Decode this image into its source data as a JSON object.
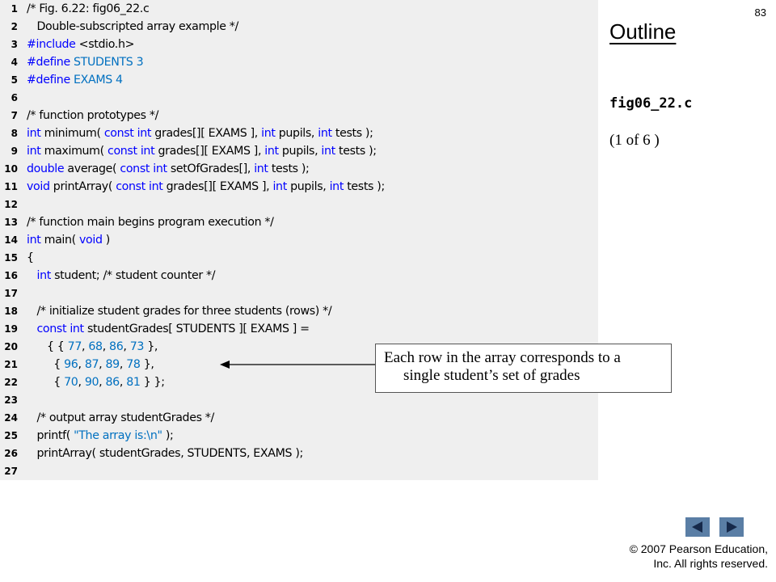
{
  "slide_number": "83",
  "outline_title": "Outline",
  "file_name": "fig06_22.c",
  "page_indicator": "(1 of 6 )",
  "callout_line1": "Each row in the array corresponds to a",
  "callout_line2": "single student’s set of grades",
  "copyright_line1": "© 2007 Pearson Education,",
  "copyright_line2": "Inc.  All rights reserved.",
  "nav": {
    "prev_icon": "triangle-left",
    "next_icon": "triangle-right"
  },
  "colors": {
    "keyword": "#0000ff",
    "literal": "#0070c0",
    "code_bg": "#efefef",
    "nav_button": "#5a7ea5"
  },
  "code_lines": [
    {
      "num": "1",
      "tokens": [
        [
          "c",
          "/* Fig. 6.22: fig06_22.c"
        ]
      ]
    },
    {
      "num": "2",
      "tokens": [
        [
          "c",
          "   Double-subscripted array example */"
        ]
      ]
    },
    {
      "num": "3",
      "tokens": [
        [
          "k",
          "#include"
        ],
        [
          "p",
          " <stdio.h>"
        ]
      ]
    },
    {
      "num": "4",
      "tokens": [
        [
          "k",
          "#define"
        ],
        [
          "p",
          " "
        ],
        [
          "n",
          "STUDENTS 3"
        ]
      ]
    },
    {
      "num": "5",
      "tokens": [
        [
          "k",
          "#define"
        ],
        [
          "p",
          " "
        ],
        [
          "n",
          "EXAMS 4"
        ]
      ]
    },
    {
      "num": "6",
      "tokens": []
    },
    {
      "num": "7",
      "tokens": [
        [
          "c",
          "/* function prototypes */"
        ]
      ]
    },
    {
      "num": "8",
      "tokens": [
        [
          "k",
          "int"
        ],
        [
          "p",
          " minimum( "
        ],
        [
          "k",
          "const int"
        ],
        [
          "p",
          " grades[][ EXAMS ], "
        ],
        [
          "k",
          "int"
        ],
        [
          "p",
          " pupils, "
        ],
        [
          "k",
          "int"
        ],
        [
          "p",
          " tests );"
        ]
      ]
    },
    {
      "num": "9",
      "tokens": [
        [
          "k",
          "int"
        ],
        [
          "p",
          " maximum( "
        ],
        [
          "k",
          "const int"
        ],
        [
          "p",
          " grades[][ EXAMS ], "
        ],
        [
          "k",
          "int"
        ],
        [
          "p",
          " pupils, "
        ],
        [
          "k",
          "int"
        ],
        [
          "p",
          " tests );"
        ]
      ]
    },
    {
      "num": "10",
      "tokens": [
        [
          "k",
          "double"
        ],
        [
          "p",
          " average( "
        ],
        [
          "k",
          "const int"
        ],
        [
          "p",
          " setOfGrades[], "
        ],
        [
          "k",
          "int"
        ],
        [
          "p",
          " tests );"
        ]
      ]
    },
    {
      "num": "11",
      "tokens": [
        [
          "k",
          "void"
        ],
        [
          "p",
          " printArray( "
        ],
        [
          "k",
          "const int"
        ],
        [
          "p",
          " grades[][ EXAMS ], "
        ],
        [
          "k",
          "int"
        ],
        [
          "p",
          " pupils, "
        ],
        [
          "k",
          "int"
        ],
        [
          "p",
          " tests );"
        ]
      ]
    },
    {
      "num": "12",
      "tokens": []
    },
    {
      "num": "13",
      "tokens": [
        [
          "c",
          "/* function main begins program execution */"
        ]
      ]
    },
    {
      "num": "14",
      "tokens": [
        [
          "k",
          "int"
        ],
        [
          "p",
          " main( "
        ],
        [
          "k",
          "void"
        ],
        [
          "p",
          " )"
        ]
      ]
    },
    {
      "num": "15",
      "tokens": [
        [
          "p",
          "{"
        ]
      ]
    },
    {
      "num": "16",
      "tokens": [
        [
          "p",
          "   "
        ],
        [
          "k",
          "int"
        ],
        [
          "p",
          " student; "
        ],
        [
          "c",
          "/* student counter */"
        ]
      ]
    },
    {
      "num": "17",
      "tokens": []
    },
    {
      "num": "18",
      "tokens": [
        [
          "p",
          "   "
        ],
        [
          "c",
          "/* initialize student grades for three students (rows) */"
        ]
      ]
    },
    {
      "num": "19",
      "tokens": [
        [
          "p",
          "   "
        ],
        [
          "k",
          "const int"
        ],
        [
          "p",
          " studentGrades[ STUDENTS ][ EXAMS ] ="
        ]
      ]
    },
    {
      "num": "20",
      "tokens": [
        [
          "p",
          "      { { "
        ],
        [
          "n",
          "77"
        ],
        [
          "p",
          ", "
        ],
        [
          "n",
          "68"
        ],
        [
          "p",
          ", "
        ],
        [
          "n",
          "86"
        ],
        [
          "p",
          ", "
        ],
        [
          "n",
          "73"
        ],
        [
          "p",
          " },"
        ]
      ]
    },
    {
      "num": "21",
      "tokens": [
        [
          "p",
          "        { "
        ],
        [
          "n",
          "96"
        ],
        [
          "p",
          ", "
        ],
        [
          "n",
          "87"
        ],
        [
          "p",
          ", "
        ],
        [
          "n",
          "89"
        ],
        [
          "p",
          ", "
        ],
        [
          "n",
          "78"
        ],
        [
          "p",
          " },"
        ]
      ]
    },
    {
      "num": "22",
      "tokens": [
        [
          "p",
          "        { "
        ],
        [
          "n",
          "70"
        ],
        [
          "p",
          ", "
        ],
        [
          "n",
          "90"
        ],
        [
          "p",
          ", "
        ],
        [
          "n",
          "86"
        ],
        [
          "p",
          ", "
        ],
        [
          "n",
          "81"
        ],
        [
          "p",
          " } };"
        ]
      ]
    },
    {
      "num": "23",
      "tokens": []
    },
    {
      "num": "24",
      "tokens": [
        [
          "p",
          "   "
        ],
        [
          "c",
          "/* output array studentGrades */"
        ]
      ]
    },
    {
      "num": "25",
      "tokens": [
        [
          "p",
          "   printf( "
        ],
        [
          "s",
          "\"The array is:\\n\""
        ],
        [
          "p",
          " );"
        ]
      ]
    },
    {
      "num": "26",
      "tokens": [
        [
          "p",
          "   printArray( studentGrades, STUDENTS, EXAMS );"
        ]
      ]
    },
    {
      "num": "27",
      "tokens": []
    }
  ]
}
